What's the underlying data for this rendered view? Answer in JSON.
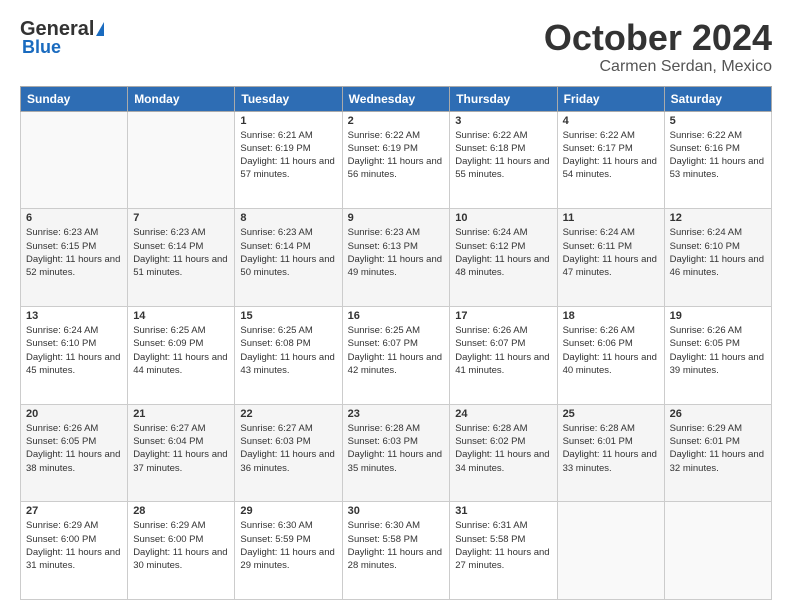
{
  "header": {
    "logo_line1": "General",
    "logo_line2": "Blue",
    "month": "October 2024",
    "location": "Carmen Serdan, Mexico"
  },
  "days_of_week": [
    "Sunday",
    "Monday",
    "Tuesday",
    "Wednesday",
    "Thursday",
    "Friday",
    "Saturday"
  ],
  "weeks": [
    [
      {
        "day": "",
        "sunrise": "",
        "sunset": "",
        "daylight": ""
      },
      {
        "day": "",
        "sunrise": "",
        "sunset": "",
        "daylight": ""
      },
      {
        "day": "1",
        "sunrise": "Sunrise: 6:21 AM",
        "sunset": "Sunset: 6:19 PM",
        "daylight": "Daylight: 11 hours and 57 minutes."
      },
      {
        "day": "2",
        "sunrise": "Sunrise: 6:22 AM",
        "sunset": "Sunset: 6:19 PM",
        "daylight": "Daylight: 11 hours and 56 minutes."
      },
      {
        "day": "3",
        "sunrise": "Sunrise: 6:22 AM",
        "sunset": "Sunset: 6:18 PM",
        "daylight": "Daylight: 11 hours and 55 minutes."
      },
      {
        "day": "4",
        "sunrise": "Sunrise: 6:22 AM",
        "sunset": "Sunset: 6:17 PM",
        "daylight": "Daylight: 11 hours and 54 minutes."
      },
      {
        "day": "5",
        "sunrise": "Sunrise: 6:22 AM",
        "sunset": "Sunset: 6:16 PM",
        "daylight": "Daylight: 11 hours and 53 minutes."
      }
    ],
    [
      {
        "day": "6",
        "sunrise": "Sunrise: 6:23 AM",
        "sunset": "Sunset: 6:15 PM",
        "daylight": "Daylight: 11 hours and 52 minutes."
      },
      {
        "day": "7",
        "sunrise": "Sunrise: 6:23 AM",
        "sunset": "Sunset: 6:14 PM",
        "daylight": "Daylight: 11 hours and 51 minutes."
      },
      {
        "day": "8",
        "sunrise": "Sunrise: 6:23 AM",
        "sunset": "Sunset: 6:14 PM",
        "daylight": "Daylight: 11 hours and 50 minutes."
      },
      {
        "day": "9",
        "sunrise": "Sunrise: 6:23 AM",
        "sunset": "Sunset: 6:13 PM",
        "daylight": "Daylight: 11 hours and 49 minutes."
      },
      {
        "day": "10",
        "sunrise": "Sunrise: 6:24 AM",
        "sunset": "Sunset: 6:12 PM",
        "daylight": "Daylight: 11 hours and 48 minutes."
      },
      {
        "day": "11",
        "sunrise": "Sunrise: 6:24 AM",
        "sunset": "Sunset: 6:11 PM",
        "daylight": "Daylight: 11 hours and 47 minutes."
      },
      {
        "day": "12",
        "sunrise": "Sunrise: 6:24 AM",
        "sunset": "Sunset: 6:10 PM",
        "daylight": "Daylight: 11 hours and 46 minutes."
      }
    ],
    [
      {
        "day": "13",
        "sunrise": "Sunrise: 6:24 AM",
        "sunset": "Sunset: 6:10 PM",
        "daylight": "Daylight: 11 hours and 45 minutes."
      },
      {
        "day": "14",
        "sunrise": "Sunrise: 6:25 AM",
        "sunset": "Sunset: 6:09 PM",
        "daylight": "Daylight: 11 hours and 44 minutes."
      },
      {
        "day": "15",
        "sunrise": "Sunrise: 6:25 AM",
        "sunset": "Sunset: 6:08 PM",
        "daylight": "Daylight: 11 hours and 43 minutes."
      },
      {
        "day": "16",
        "sunrise": "Sunrise: 6:25 AM",
        "sunset": "Sunset: 6:07 PM",
        "daylight": "Daylight: 11 hours and 42 minutes."
      },
      {
        "day": "17",
        "sunrise": "Sunrise: 6:26 AM",
        "sunset": "Sunset: 6:07 PM",
        "daylight": "Daylight: 11 hours and 41 minutes."
      },
      {
        "day": "18",
        "sunrise": "Sunrise: 6:26 AM",
        "sunset": "Sunset: 6:06 PM",
        "daylight": "Daylight: 11 hours and 40 minutes."
      },
      {
        "day": "19",
        "sunrise": "Sunrise: 6:26 AM",
        "sunset": "Sunset: 6:05 PM",
        "daylight": "Daylight: 11 hours and 39 minutes."
      }
    ],
    [
      {
        "day": "20",
        "sunrise": "Sunrise: 6:26 AM",
        "sunset": "Sunset: 6:05 PM",
        "daylight": "Daylight: 11 hours and 38 minutes."
      },
      {
        "day": "21",
        "sunrise": "Sunrise: 6:27 AM",
        "sunset": "Sunset: 6:04 PM",
        "daylight": "Daylight: 11 hours and 37 minutes."
      },
      {
        "day": "22",
        "sunrise": "Sunrise: 6:27 AM",
        "sunset": "Sunset: 6:03 PM",
        "daylight": "Daylight: 11 hours and 36 minutes."
      },
      {
        "day": "23",
        "sunrise": "Sunrise: 6:28 AM",
        "sunset": "Sunset: 6:03 PM",
        "daylight": "Daylight: 11 hours and 35 minutes."
      },
      {
        "day": "24",
        "sunrise": "Sunrise: 6:28 AM",
        "sunset": "Sunset: 6:02 PM",
        "daylight": "Daylight: 11 hours and 34 minutes."
      },
      {
        "day": "25",
        "sunrise": "Sunrise: 6:28 AM",
        "sunset": "Sunset: 6:01 PM",
        "daylight": "Daylight: 11 hours and 33 minutes."
      },
      {
        "day": "26",
        "sunrise": "Sunrise: 6:29 AM",
        "sunset": "Sunset: 6:01 PM",
        "daylight": "Daylight: 11 hours and 32 minutes."
      }
    ],
    [
      {
        "day": "27",
        "sunrise": "Sunrise: 6:29 AM",
        "sunset": "Sunset: 6:00 PM",
        "daylight": "Daylight: 11 hours and 31 minutes."
      },
      {
        "day": "28",
        "sunrise": "Sunrise: 6:29 AM",
        "sunset": "Sunset: 6:00 PM",
        "daylight": "Daylight: 11 hours and 30 minutes."
      },
      {
        "day": "29",
        "sunrise": "Sunrise: 6:30 AM",
        "sunset": "Sunset: 5:59 PM",
        "daylight": "Daylight: 11 hours and 29 minutes."
      },
      {
        "day": "30",
        "sunrise": "Sunrise: 6:30 AM",
        "sunset": "Sunset: 5:58 PM",
        "daylight": "Daylight: 11 hours and 28 minutes."
      },
      {
        "day": "31",
        "sunrise": "Sunrise: 6:31 AM",
        "sunset": "Sunset: 5:58 PM",
        "daylight": "Daylight: 11 hours and 27 minutes."
      },
      {
        "day": "",
        "sunrise": "",
        "sunset": "",
        "daylight": ""
      },
      {
        "day": "",
        "sunrise": "",
        "sunset": "",
        "daylight": ""
      }
    ]
  ]
}
